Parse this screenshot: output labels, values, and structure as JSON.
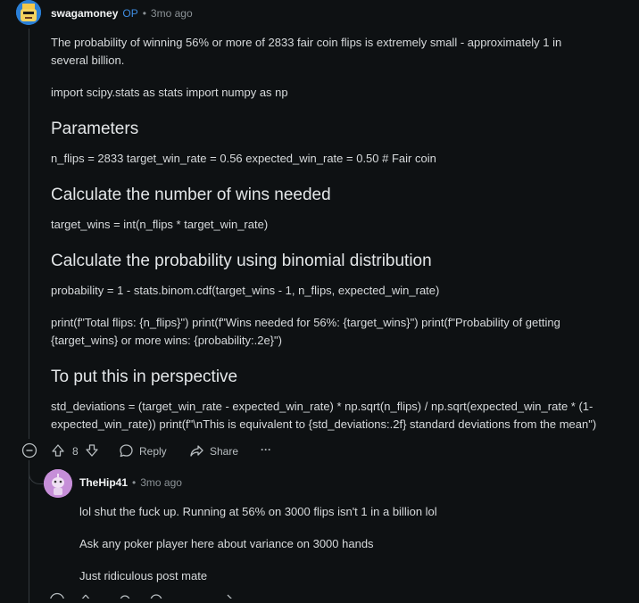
{
  "comment1": {
    "username": "swagamoney",
    "op_label": "OP",
    "dot": "•",
    "timestamp": "3mo ago",
    "para1_line1": "The probability of winning 56% or more of 2833 fair coin flips is extremely small - approximately 1 in",
    "para1_line2": "several billion.",
    "imports": "import scipy.stats as stats import numpy as np",
    "heading1": "Parameters",
    "params": "n_flips = 2833 target_win_rate = 0.56 expected_win_rate = 0.50 # Fair coin",
    "heading2": "Calculate the number of wins needed",
    "target_wins": "target_wins = int(n_flips * target_win_rate)",
    "heading3": "Calculate the probability using binomial distribution",
    "probability": "probability = 1 - stats.binom.cdf(target_wins - 1, n_flips, expected_win_rate)",
    "print_line1": "print(f\"Total flips: {n_flips}\") print(f\"Wins needed for 56%: {target_wins}\") print(f\"Probability of getting",
    "print_line2": "{target_wins} or more wins: {probability:.2e}\")",
    "heading4": "To put this in perspective",
    "std_line1": "std_deviations = (target_win_rate - expected_win_rate) * np.sqrt(n_flips) / np.sqrt(expected_win_rate * (1-",
    "std_line2": "expected_win_rate)) print(f\"\\nThis is equivalent to {std_deviations:.2f} standard deviations from the mean\")",
    "actions": {
      "collapse_icon": "minus-circle-icon",
      "vote_count": "8",
      "reply_label": "Reply",
      "share_label": "Share",
      "more_label": "···"
    }
  },
  "comment2": {
    "username": "TheHip41",
    "dot": "•",
    "timestamp": "3mo ago",
    "line1": "lol shut the fuck up. Running at 56% on 3000 flips isn't 1 in a billion lol",
    "line2": "Ask any poker player here about variance on 3000 hands",
    "line3": "Just ridiculous post mate"
  },
  "colors": {
    "background": "#0e1113",
    "text": "#d7dadc",
    "op_blue": "#3f8de2",
    "meta": "#8b9296"
  }
}
